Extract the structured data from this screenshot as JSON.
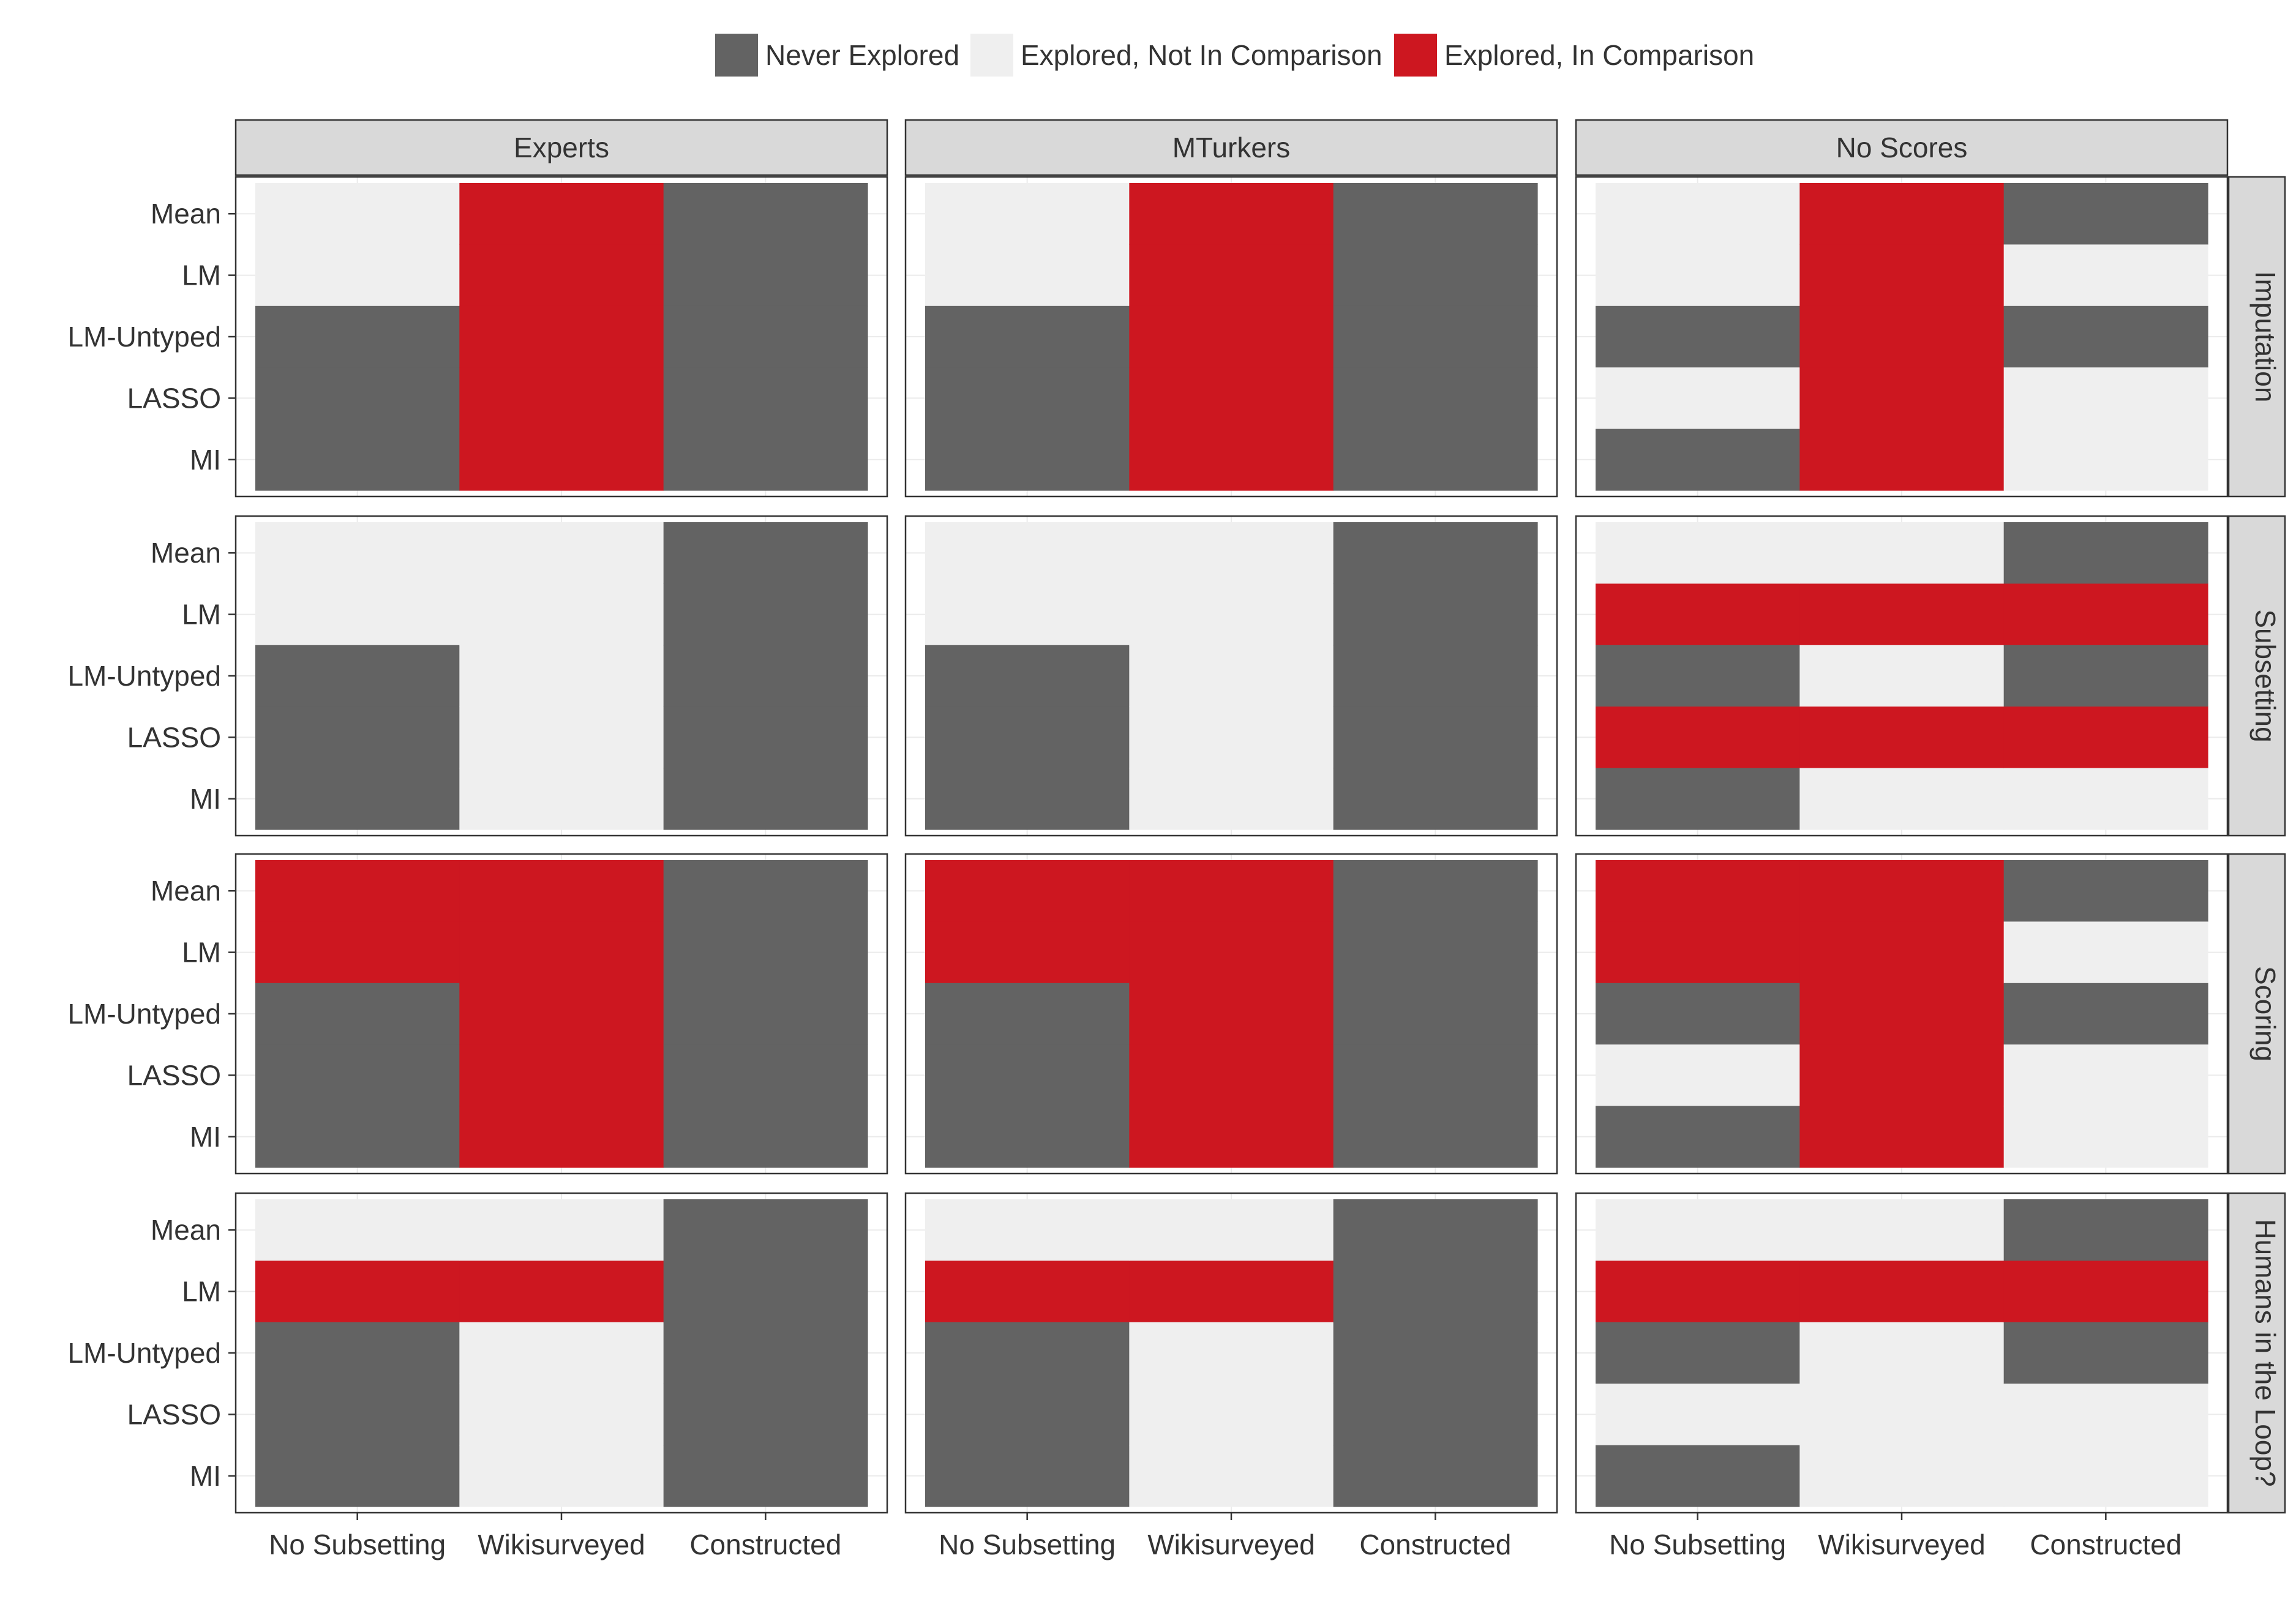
{
  "chart_data": {
    "type": "heatmap",
    "legend": {
      "position": "top",
      "items": [
        {
          "key": "N",
          "label": "Never Explored",
          "color": "#636363"
        },
        {
          "key": "E",
          "label": "Explored, Not In Comparison",
          "color": "#efefef"
        },
        {
          "key": "C",
          "label": "Explored, In Comparison",
          "color": "#cd1720"
        }
      ]
    },
    "x_categories": [
      "No Subsetting",
      "Wikisurveyed",
      "Constructed"
    ],
    "y_categories": [
      "Mean",
      "LM",
      "LM-Untyped",
      "LASSO",
      "MI"
    ],
    "columns": [
      "Experts",
      "MTurkers",
      "No Scores"
    ],
    "rows": [
      "Imputation",
      "Subsetting",
      "Scoring",
      "Humans in the Loop?"
    ],
    "cell_values_note": "N = Never Explored, E = Explored Not In Comparison, C = Explored In Comparison; each panel is 3 columns (x) of 5 levels (y, Mean..MI)",
    "panels": [
      [
        [
          [
            "E",
            "E",
            "N",
            "N",
            "N"
          ],
          [
            "C",
            "C",
            "C",
            "C",
            "C"
          ],
          [
            "N",
            "N",
            "N",
            "N",
            "N"
          ]
        ],
        [
          [
            "E",
            "E",
            "N",
            "N",
            "N"
          ],
          [
            "C",
            "C",
            "C",
            "C",
            "C"
          ],
          [
            "N",
            "N",
            "N",
            "N",
            "N"
          ]
        ],
        [
          [
            "E",
            "E",
            "N",
            "E",
            "N"
          ],
          [
            "C",
            "C",
            "C",
            "C",
            "C"
          ],
          [
            "N",
            "E",
            "N",
            "E",
            "E"
          ]
        ]
      ],
      [
        [
          [
            "E",
            "E",
            "N",
            "N",
            "N"
          ],
          [
            "E",
            "E",
            "E",
            "E",
            "E"
          ],
          [
            "N",
            "N",
            "N",
            "N",
            "N"
          ]
        ],
        [
          [
            "E",
            "E",
            "N",
            "N",
            "N"
          ],
          [
            "E",
            "E",
            "E",
            "E",
            "E"
          ],
          [
            "N",
            "N",
            "N",
            "N",
            "N"
          ]
        ],
        [
          [
            "E",
            "C",
            "N",
            "C",
            "N"
          ],
          [
            "E",
            "C",
            "E",
            "C",
            "E"
          ],
          [
            "N",
            "C",
            "N",
            "C",
            "E"
          ]
        ]
      ],
      [
        [
          [
            "C",
            "C",
            "N",
            "N",
            "N"
          ],
          [
            "C",
            "C",
            "C",
            "C",
            "C"
          ],
          [
            "N",
            "N",
            "N",
            "N",
            "N"
          ]
        ],
        [
          [
            "C",
            "C",
            "N",
            "N",
            "N"
          ],
          [
            "C",
            "C",
            "C",
            "C",
            "C"
          ],
          [
            "N",
            "N",
            "N",
            "N",
            "N"
          ]
        ],
        [
          [
            "C",
            "C",
            "N",
            "E",
            "N"
          ],
          [
            "C",
            "C",
            "C",
            "C",
            "C"
          ],
          [
            "N",
            "E",
            "N",
            "E",
            "E"
          ]
        ]
      ],
      [
        [
          [
            "E",
            "C",
            "N",
            "N",
            "N"
          ],
          [
            "E",
            "C",
            "E",
            "E",
            "E"
          ],
          [
            "N",
            "N",
            "N",
            "N",
            "N"
          ]
        ],
        [
          [
            "E",
            "C",
            "N",
            "N",
            "N"
          ],
          [
            "E",
            "C",
            "E",
            "E",
            "E"
          ],
          [
            "N",
            "N",
            "N",
            "N",
            "N"
          ]
        ],
        [
          [
            "E",
            "C",
            "N",
            "E",
            "N"
          ],
          [
            "E",
            "C",
            "E",
            "E",
            "E"
          ],
          [
            "N",
            "C",
            "N",
            "E",
            "E"
          ]
        ]
      ]
    ]
  }
}
